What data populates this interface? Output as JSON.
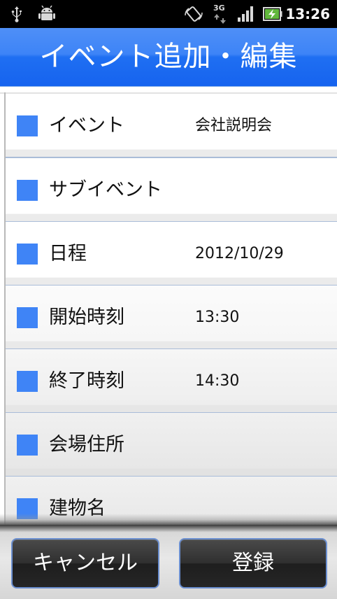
{
  "status_bar": {
    "network": "3G",
    "time": "13:26"
  },
  "header": {
    "title": "イベント追加・編集"
  },
  "form": {
    "items": [
      {
        "label": "イベント",
        "value": "会社説明会"
      },
      {
        "label": "サブイベント",
        "value": ""
      },
      {
        "label": "日程",
        "value": "2012/10/29"
      },
      {
        "label": "開始時刻",
        "value": "13:30"
      },
      {
        "label": "終了時刻",
        "value": "14:30"
      },
      {
        "label": "会場住所",
        "value": ""
      },
      {
        "label": "建物名",
        "value": ""
      }
    ]
  },
  "footer": {
    "cancel_label": "キャンセル",
    "register_label": "登録"
  },
  "colors": {
    "accent": "#3f84f6",
    "title_bar": "#1f6ff2",
    "button_border": "#6b8fd0"
  }
}
